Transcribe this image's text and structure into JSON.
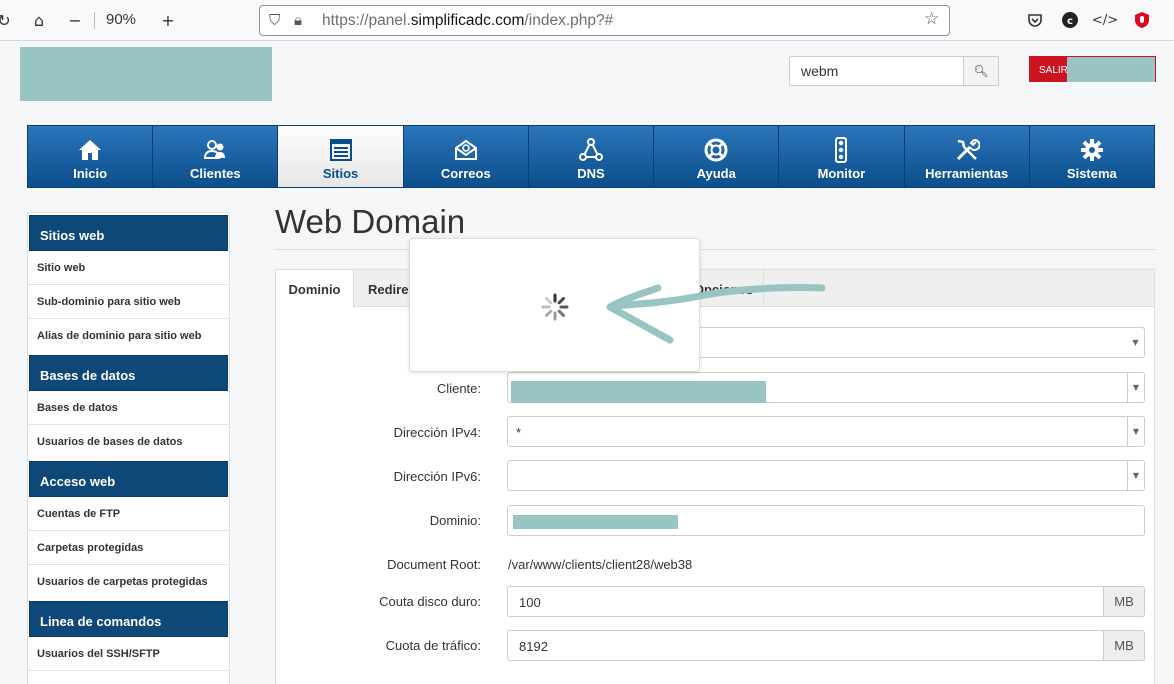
{
  "browser": {
    "zoom": "90%",
    "url_prefix": "https://panel.",
    "url_domain": "simplificadc.com",
    "url_path": "/index.php?#"
  },
  "header": {
    "search_value": "webm",
    "logout_label": "SALIR"
  },
  "nav": {
    "items": [
      {
        "label": "Inicio",
        "icon": "home-icon"
      },
      {
        "label": "Clientes",
        "icon": "users-icon"
      },
      {
        "label": "Sitios",
        "icon": "sites-icon"
      },
      {
        "label": "Correos",
        "icon": "mail-icon"
      },
      {
        "label": "DNS",
        "icon": "dns-icon"
      },
      {
        "label": "Ayuda",
        "icon": "lifebuoy-icon"
      },
      {
        "label": "Monitor",
        "icon": "traffic-light-icon"
      },
      {
        "label": "Herramientas",
        "icon": "tools-icon"
      },
      {
        "label": "Sistema",
        "icon": "gear-icon"
      }
    ],
    "active": "Sitios"
  },
  "sidebar": {
    "sections": [
      {
        "title": "Sitios web",
        "items": [
          "Sitio web",
          "Sub-dominio para sitio web",
          "Alias de dominio para sitio web"
        ]
      },
      {
        "title": "Bases de datos",
        "items": [
          "Bases de datos",
          "Usuarios de bases de datos"
        ]
      },
      {
        "title": "Acceso web",
        "items": [
          "Cuentas de FTP",
          "Carpetas protegidas",
          "Usuarios de carpetas protegidas"
        ]
      },
      {
        "title": "Linea de comandos",
        "items": [
          "Usuarios del SSH/SFTP"
        ]
      }
    ]
  },
  "content": {
    "title": "Web Domain",
    "tabs": {
      "dominio": "Dominio",
      "redirect": "Redirec",
      "opciones": "Opciones"
    },
    "form": {
      "cliente_label": "Cliente:",
      "ipv4_label": "Dirección IPv4:",
      "ipv4_value": "*",
      "ipv6_label": "Dirección IPv6:",
      "dominio_label": "Dominio:",
      "docroot_label": "Document Root:",
      "docroot_value": "/var/www/clients/client28/web38",
      "disk_label": "Couta disco duro:",
      "disk_value": "100",
      "disk_unit": "MB",
      "traffic_label": "Cuota de tráfico:",
      "traffic_value": "8192",
      "traffic_unit": "MB"
    }
  }
}
